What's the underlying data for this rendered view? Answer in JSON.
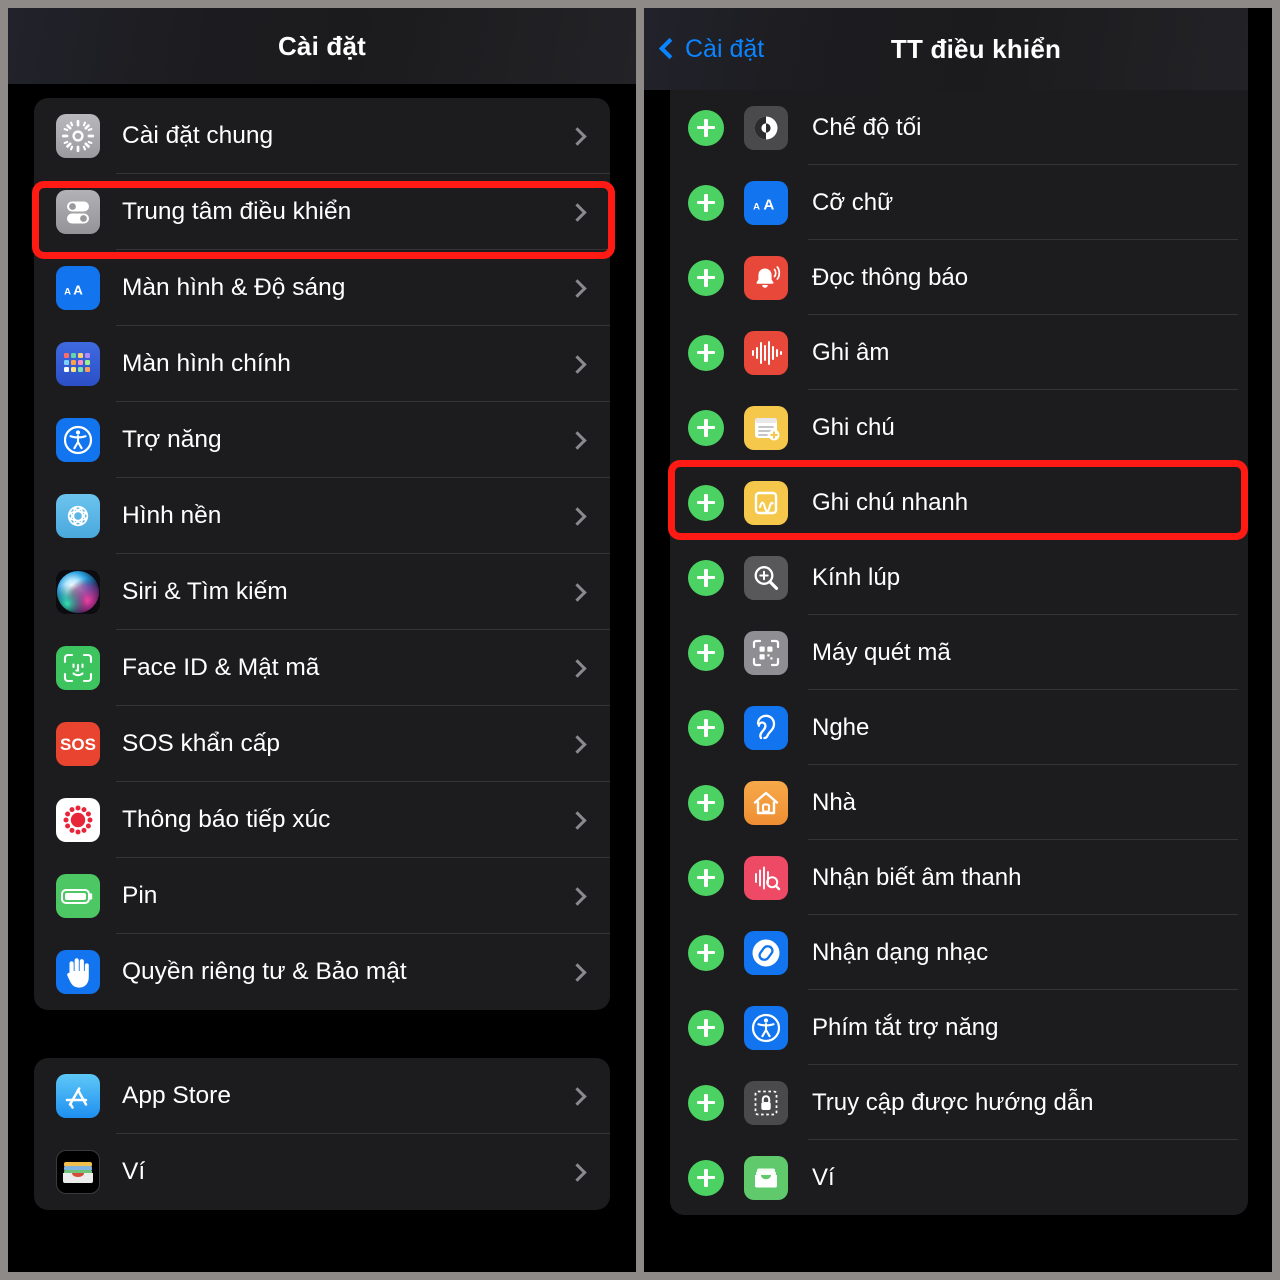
{
  "theme": {
    "accent_blue": "#0a84ff",
    "highlight_red": "#ff1a14",
    "plus_green": "#4cd263",
    "card_bg": "#1c1c1e",
    "page_bg": "#000000",
    "frame_gray": "#8d8a87"
  },
  "left_pane": {
    "nav": {
      "title": "Cài đặt"
    },
    "groups": [
      {
        "id": "group-main",
        "rows": [
          {
            "label": "Cài đặt chung",
            "icon": "gear-icon",
            "chevron": true,
            "highlighted": false
          },
          {
            "label": "Trung tâm điều khiển",
            "icon": "control-center-icon",
            "chevron": true,
            "highlighted": true
          },
          {
            "label": "Màn hình & Độ sáng",
            "icon": "display-brightness-icon",
            "chevron": true,
            "highlighted": false
          },
          {
            "label": "Màn hình chính",
            "icon": "home-screen-icon",
            "chevron": true,
            "highlighted": false
          },
          {
            "label": "Trợ năng",
            "icon": "accessibility-icon",
            "chevron": true,
            "highlighted": false
          },
          {
            "label": "Hình nền",
            "icon": "wallpaper-icon",
            "chevron": true,
            "highlighted": false
          },
          {
            "label": "Siri & Tìm kiếm",
            "icon": "siri-icon",
            "chevron": true,
            "highlighted": false
          },
          {
            "label": "Face ID & Mật mã",
            "icon": "face-id-icon",
            "chevron": true,
            "highlighted": false
          },
          {
            "label": "SOS khẩn cấp",
            "icon": "sos-icon",
            "chevron": true,
            "highlighted": false
          },
          {
            "label": "Thông báo tiếp xúc",
            "icon": "exposure-notification-icon",
            "chevron": true,
            "highlighted": false
          },
          {
            "label": "Pin",
            "icon": "battery-icon",
            "chevron": true,
            "highlighted": false
          },
          {
            "label": "Quyền riêng tư & Bảo mật",
            "icon": "privacy-hand-icon",
            "chevron": true,
            "highlighted": false
          }
        ]
      },
      {
        "id": "group-store",
        "rows": [
          {
            "label": "App Store",
            "icon": "app-store-icon",
            "chevron": true,
            "highlighted": false
          },
          {
            "label": "Ví",
            "icon": "wallet-icon",
            "chevron": true,
            "highlighted": false
          }
        ]
      }
    ]
  },
  "right_pane": {
    "nav": {
      "back_label": "Cài đặt",
      "title": "TT điều khiển"
    },
    "rows": [
      {
        "label": "Chế độ tối",
        "icon": "dark-mode-icon",
        "action": "add",
        "highlighted": false
      },
      {
        "label": "Cỡ chữ",
        "icon": "text-size-icon",
        "action": "add",
        "highlighted": false
      },
      {
        "label": "Đọc thông báo",
        "icon": "announce-notifications-icon",
        "action": "add",
        "highlighted": false
      },
      {
        "label": "Ghi âm",
        "icon": "voice-memos-icon",
        "action": "add",
        "highlighted": false
      },
      {
        "label": "Ghi chú",
        "icon": "notes-icon",
        "action": "add",
        "highlighted": false
      },
      {
        "label": "Ghi chú nhanh",
        "icon": "quick-note-icon",
        "action": "add",
        "highlighted": false
      },
      {
        "label": "Kính lúp",
        "icon": "magnifier-icon",
        "action": "add",
        "highlighted": true
      },
      {
        "label": "Máy quét mã",
        "icon": "code-scanner-icon",
        "action": "add",
        "highlighted": false
      },
      {
        "label": "Nghe",
        "icon": "hearing-icon",
        "action": "add",
        "highlighted": false
      },
      {
        "label": "Nhà",
        "icon": "home-app-icon",
        "action": "add",
        "highlighted": false
      },
      {
        "label": "Nhận biết âm thanh",
        "icon": "sound-recognition-icon",
        "action": "add",
        "highlighted": false
      },
      {
        "label": "Nhận dạng nhạc",
        "icon": "shazam-icon",
        "action": "add",
        "highlighted": false
      },
      {
        "label": "Phím tắt trợ năng",
        "icon": "accessibility-shortcut-icon",
        "action": "add",
        "highlighted": false
      },
      {
        "label": "Truy cập được hướng dẫn",
        "icon": "guided-access-icon",
        "action": "add",
        "highlighted": false
      },
      {
        "label": "Ví",
        "icon": "wallet-green-icon",
        "action": "add",
        "highlighted": false
      }
    ]
  }
}
